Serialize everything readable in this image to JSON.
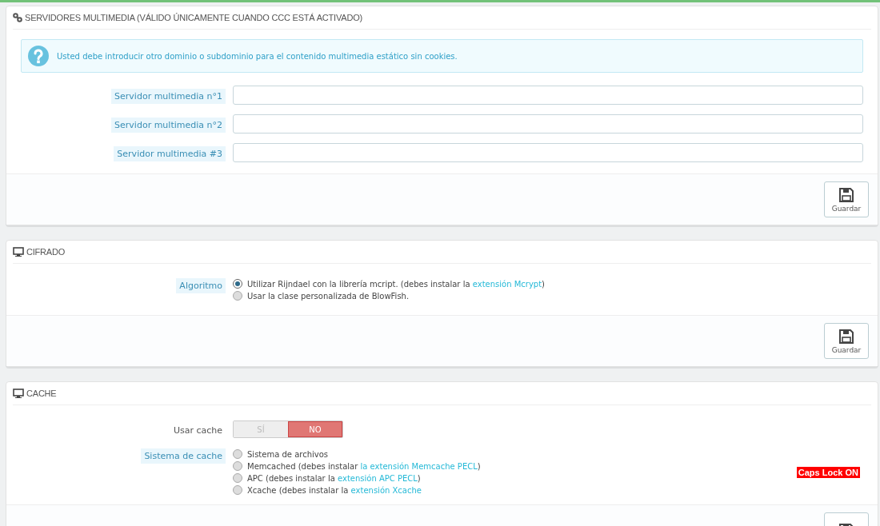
{
  "panels": [
    {
      "title": "SERVIDORES MULTIMEDIA (VÁLIDO ÚNICAMENTE CUANDO CCC ESTÁ ACTIVADO)",
      "alert": {
        "text": "Usted debe introducir otro dominio o subdominio para el contenido multimedia estático sin cookies."
      },
      "fields": [
        {
          "kind": "text",
          "label": "Servidor multimedia n°1",
          "hint": true
        },
        {
          "kind": "text",
          "label": "Servidor multimedia n°2",
          "hint": true
        },
        {
          "kind": "text",
          "label": "Servidor multimedia #3",
          "hint": true
        }
      ],
      "footer_button": {
        "kind": "save",
        "label": "Guardar"
      }
    },
    {
      "title": "CIFRADO",
      "fields": [
        {
          "kind": "radio",
          "label": "Algoritmo",
          "hint": true,
          "options": [
            {
              "selected": true,
              "text": "Utilizar Rijndael con la librería mcript. (debes instalar la ",
              "link": "extensión Mcrypt",
              "suffix": ")"
            },
            {
              "selected": false,
              "text": "Usar la clase personalizada de BlowFish."
            }
          ]
        }
      ],
      "footer_button": {
        "kind": "save",
        "label": "Guardar"
      }
    },
    {
      "title": "CACHE",
      "badge": "Caps Lock ON",
      "fields": [
        {
          "kind": "switch",
          "label": "Usar cache",
          "hint": false,
          "on": false,
          "on_label": "SÍ",
          "off_label": "NO"
        },
        {
          "kind": "radio",
          "label": "Sistema de cache",
          "hint": true,
          "options": [
            {
              "selected": false,
              "text": "Sistema de archivos"
            },
            {
              "selected": false,
              "text": "Memcached (debes instalar ",
              "link": "la extensión Memcache PECL",
              "suffix": ")"
            },
            {
              "selected": false,
              "text": "APC (debes instalar la ",
              "link": "extensión APC PECL",
              "suffix": ")"
            },
            {
              "selected": false,
              "text": "Xcache (debes instalar la ",
              "link": "extensión Xcache"
            }
          ]
        }
      ],
      "footer_button": {
        "kind": "save"
      }
    }
  ]
}
